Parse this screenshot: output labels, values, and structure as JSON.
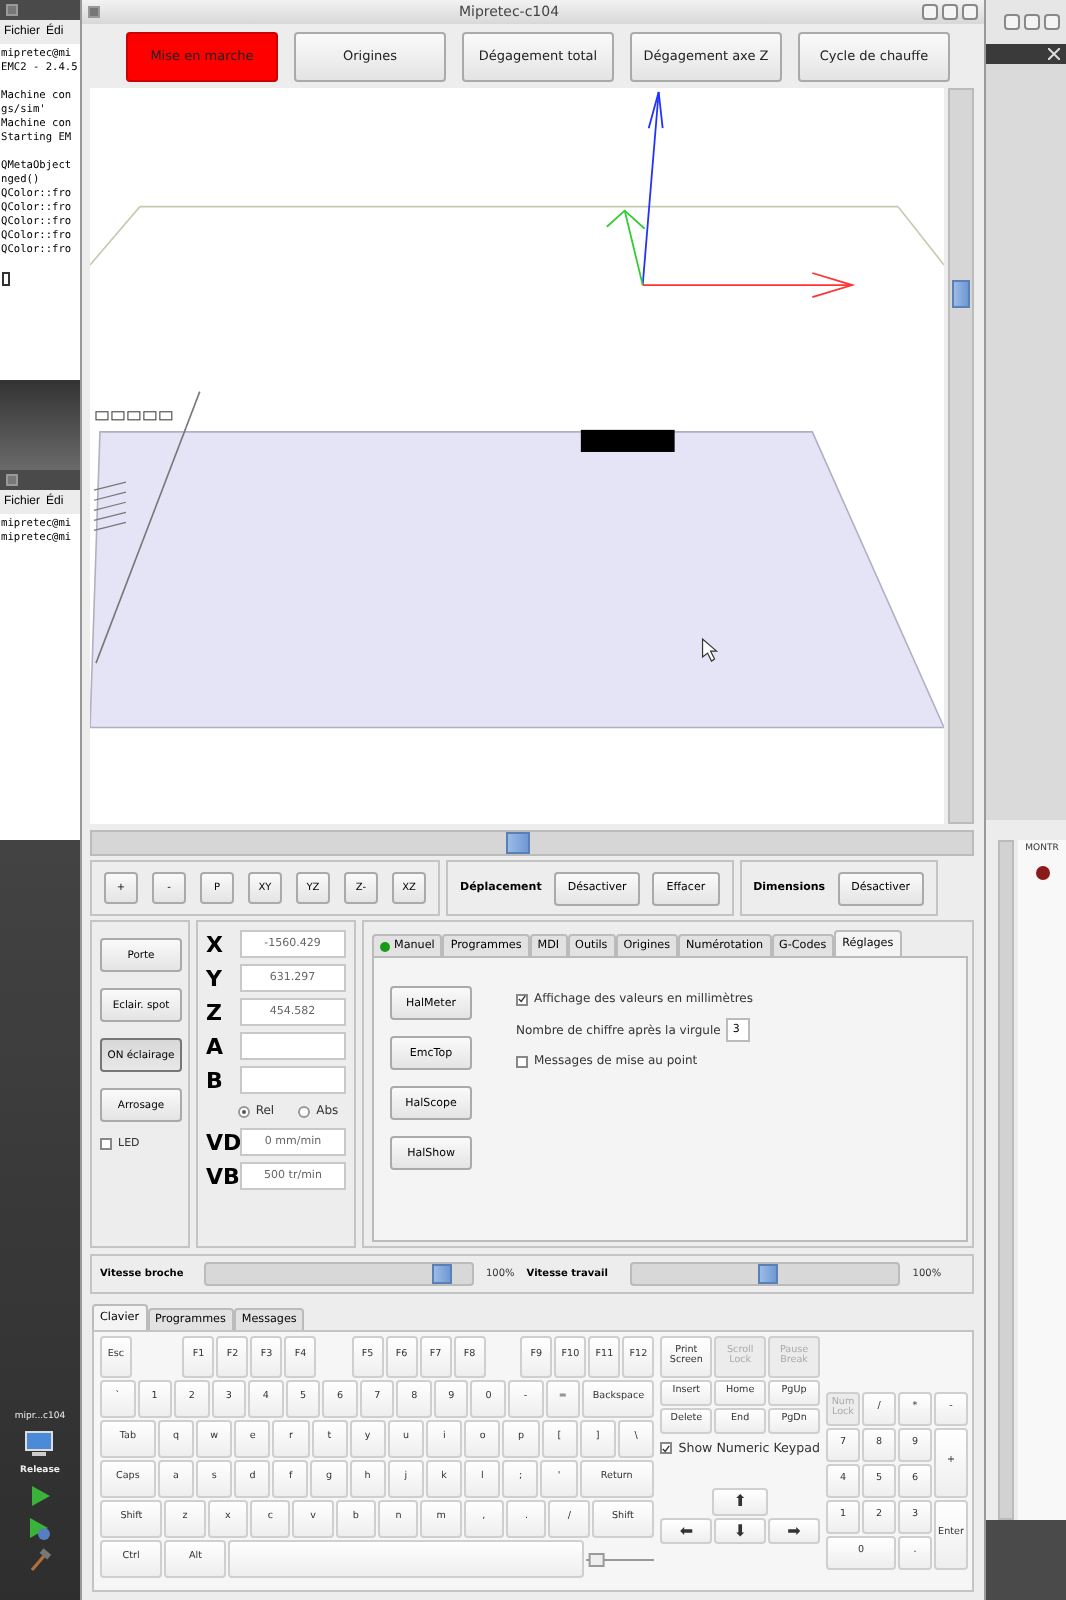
{
  "background_terminal": {
    "menu": [
      "Fichier",
      "Édi"
    ],
    "blocks": [
      [
        "mipretec@mi",
        "EMC2 - 2.4.5"
      ],
      [
        "Machine con",
        "gs/sim'",
        "Machine con",
        "Starting EM"
      ],
      [
        "QMetaObject",
        "nged()",
        "QColor::fro",
        "QColor::fro",
        "QColor::fro",
        "QColor::fro",
        "QColor::fro"
      ]
    ]
  },
  "second_terminal": {
    "menu": [
      "Fichier",
      "Édi"
    ],
    "lines": [
      "mipretec@mi",
      "mipretec@mi"
    ]
  },
  "dock": {
    "label": "mipr...c104",
    "item": "Release"
  },
  "right_window": {
    "title": "MONTR"
  },
  "window": {
    "title": "Mipretec-c104"
  },
  "toolbar": [
    {
      "label": "Mise en marche",
      "active": true
    },
    {
      "label": "Origines",
      "active": false
    },
    {
      "label": "Dégagement total",
      "active": false
    },
    {
      "label": "Dégagement axe Z",
      "active": false
    },
    {
      "label": "Cycle de chauffe",
      "active": false
    }
  ],
  "view_buttons": [
    "+",
    "-",
    "P",
    "XY",
    "YZ",
    "Z-",
    "XZ"
  ],
  "deplacement": {
    "label": "Déplacement",
    "buttons": [
      "Désactiver",
      "Effacer"
    ]
  },
  "dimensions": {
    "label": "Dimensions",
    "buttons": [
      "Désactiver"
    ]
  },
  "side_buttons": [
    {
      "label": "Porte",
      "pressed": false
    },
    {
      "label": "Eclair. spot",
      "pressed": false
    },
    {
      "label": "ON éclairage",
      "pressed": true
    },
    {
      "label": "Arrosage",
      "pressed": false
    }
  ],
  "led": {
    "label": "LED",
    "checked": false
  },
  "axes": [
    {
      "name": "X",
      "value": "-1560.429"
    },
    {
      "name": "Y",
      "value": "631.297"
    },
    {
      "name": "Z",
      "value": "454.582"
    },
    {
      "name": "A"
    },
    {
      "name": "B"
    }
  ],
  "coord_mode": [
    {
      "label": "Rel",
      "selected": true
    },
    {
      "label": "Abs",
      "selected": false
    }
  ],
  "rates": [
    {
      "name": "VD",
      "value": "0 mm/min"
    },
    {
      "name": "VB",
      "value": "500 tr/min"
    }
  ],
  "tabs": [
    {
      "label": "Manuel",
      "selected": false,
      "indicator": true
    },
    {
      "label": "Programmes",
      "selected": false,
      "indicator": false
    },
    {
      "label": "MDI",
      "selected": false,
      "indicator": false
    },
    {
      "label": "Outils",
      "selected": false,
      "indicator": false
    },
    {
      "label": "Origines",
      "selected": false,
      "indicator": false
    },
    {
      "label": "Numérotation",
      "selected": false,
      "indicator": false
    },
    {
      "label": "G-Codes",
      "selected": false,
      "indicator": false
    },
    {
      "label": "Réglages",
      "selected": true,
      "indicator": false
    }
  ],
  "tools": [
    "HalMeter",
    "EmcTop",
    "HalScope",
    "HalShow"
  ],
  "settings": {
    "mm_display": {
      "label": "Affichage des valeurs en millimètres",
      "checked": true
    },
    "decimals": {
      "label": "Nombre de chiffre après la virgule",
      "value": "3"
    },
    "debug": {
      "label": "Messages de mise au point",
      "checked": false
    }
  },
  "speeds": [
    {
      "label": "Vitesse broche",
      "level": 0.93,
      "reading": "100%"
    },
    {
      "label": "Vitesse travail",
      "level": 0.52,
      "reading": "100%"
    }
  ],
  "bottom_tabs": [
    {
      "label": "Clavier",
      "selected": true
    },
    {
      "label": "Programmes",
      "selected": false
    },
    {
      "label": "Messages",
      "selected": false
    }
  ],
  "keyboard": {
    "function_groups": [
      [
        "Esc"
      ],
      [
        "F1",
        "F2",
        "F3",
        "F4"
      ],
      [
        "F5",
        "F6",
        "F7",
        "F8"
      ],
      [
        "F9",
        "F10",
        "F11",
        "F12"
      ]
    ],
    "system_keys": [
      {
        "label": "Print Screen",
        "disabled": false
      },
      {
        "label": "Scroll Lock",
        "disabled": true
      },
      {
        "label": "Pause Break",
        "disabled": true
      }
    ],
    "main_rows": [
      [
        "`",
        "1",
        "2",
        "3",
        "4",
        "5",
        "6",
        "7",
        "8",
        "9",
        "0",
        "-",
        "=",
        "Backspace"
      ],
      [
        "Tab",
        "q",
        "w",
        "e",
        "r",
        "t",
        "y",
        "u",
        "i",
        "o",
        "p",
        "[",
        "]",
        "\\"
      ],
      [
        "Caps",
        "a",
        "s",
        "d",
        "f",
        "g",
        "h",
        "j",
        "k",
        "l",
        ";",
        "'",
        "Return"
      ],
      [
        "Shift",
        "z",
        "x",
        "c",
        "v",
        "b",
        "n",
        "m",
        ",",
        ".",
        "/",
        "Shift"
      ],
      [
        "Ctrl",
        "Alt"
      ]
    ],
    "nav_rows": [
      [
        "Insert",
        "Home",
        "PgUp"
      ],
      [
        "Delete",
        "End",
        "PgDn"
      ]
    ],
    "show_numeric_keypad": {
      "label": "Show Numeric Keypad",
      "checked": true
    },
    "size_slider": {
      "level": 0.05
    },
    "arrow_up": "⬆",
    "arrows": [
      "⬅",
      "⬇",
      "➡"
    ],
    "numpad": [
      {
        "label": "Num Lock",
        "disabled": true
      },
      {
        "label": "/",
        "disabled": false
      },
      {
        "label": "*",
        "disabled": false
      },
      {
        "label": "-",
        "disabled": false
      },
      {
        "label": "7",
        "disabled": false
      },
      {
        "label": "8",
        "disabled": false
      },
      {
        "label": "9",
        "disabled": false
      },
      {
        "label": "+",
        "disabled": false
      },
      {
        "label": "4",
        "disabled": false
      },
      {
        "label": "5",
        "disabled": false
      },
      {
        "label": "6",
        "disabled": false
      },
      {
        "label": "1",
        "disabled": false
      },
      {
        "label": "2",
        "disabled": false
      },
      {
        "label": "3",
        "disabled": false
      },
      {
        "label": "Enter",
        "disabled": false
      },
      {
        "label": "0",
        "disabled": false
      },
      {
        "label": ".",
        "disabled": false
      }
    ]
  }
}
